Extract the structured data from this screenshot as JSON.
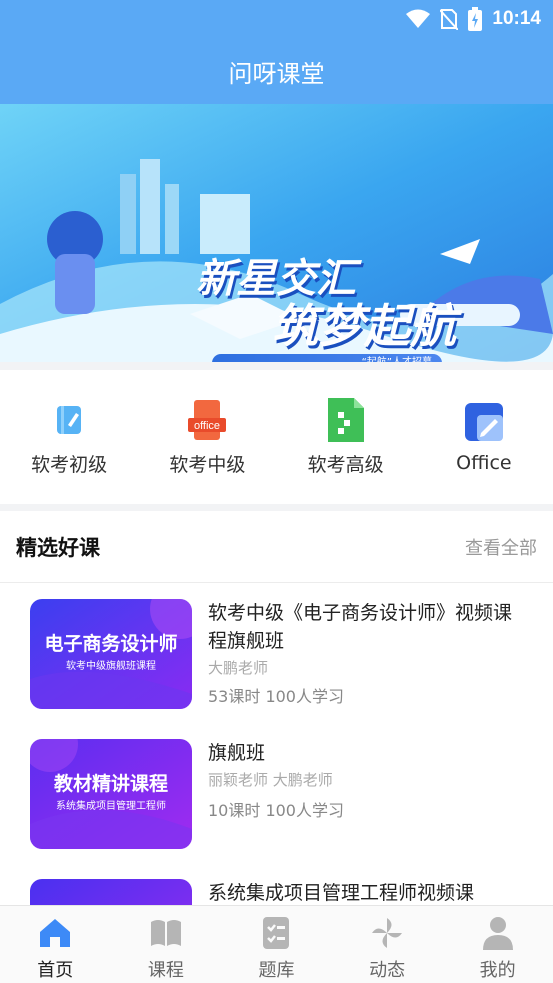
{
  "status": {
    "time": "10:14"
  },
  "header": {
    "title": "问呀课堂"
  },
  "banner": {
    "line1": "新星交汇",
    "line2": "筑梦起航",
    "tagline": "“起航”人才招募"
  },
  "categories": [
    {
      "label": "软考初级",
      "icon": "notebook-icon"
    },
    {
      "label": "软考中级",
      "icon": "office-icon"
    },
    {
      "label": "软考高级",
      "icon": "spreadsheet-icon"
    },
    {
      "label": "Office",
      "icon": "office-edit-icon"
    }
  ],
  "section": {
    "title": "精选好课",
    "more": "查看全部"
  },
  "courses": [
    {
      "thumb_title": "电子商务设计师",
      "thumb_sub": "软考中级旗舰班课程",
      "name": "软考中级《电子商务设计师》视频课程旗舰班",
      "teacher": "大鹏老师",
      "meta": "53课时 100人学习"
    },
    {
      "thumb_title": "教材精讲课程",
      "thumb_sub": "系统集成项目管理工程师",
      "name": "旗舰班",
      "teacher": "丽颖老师  大鹏老师",
      "meta": "10课时 100人学习"
    },
    {
      "thumb_title": "",
      "thumb_sub": "",
      "name": "系统集成项目管理工程师视频课",
      "teacher": "",
      "meta": ""
    }
  ],
  "tabs": [
    {
      "label": "首页",
      "icon": "home-icon",
      "active": true
    },
    {
      "label": "课程",
      "icon": "book-icon"
    },
    {
      "label": "题库",
      "icon": "checklist-icon"
    },
    {
      "label": "动态",
      "icon": "pinwheel-icon"
    },
    {
      "label": "我的",
      "icon": "user-icon"
    }
  ],
  "colors": {
    "header": "#5aa9f5",
    "accent": "#3d8af7",
    "inactive": "#b5b5b5"
  }
}
